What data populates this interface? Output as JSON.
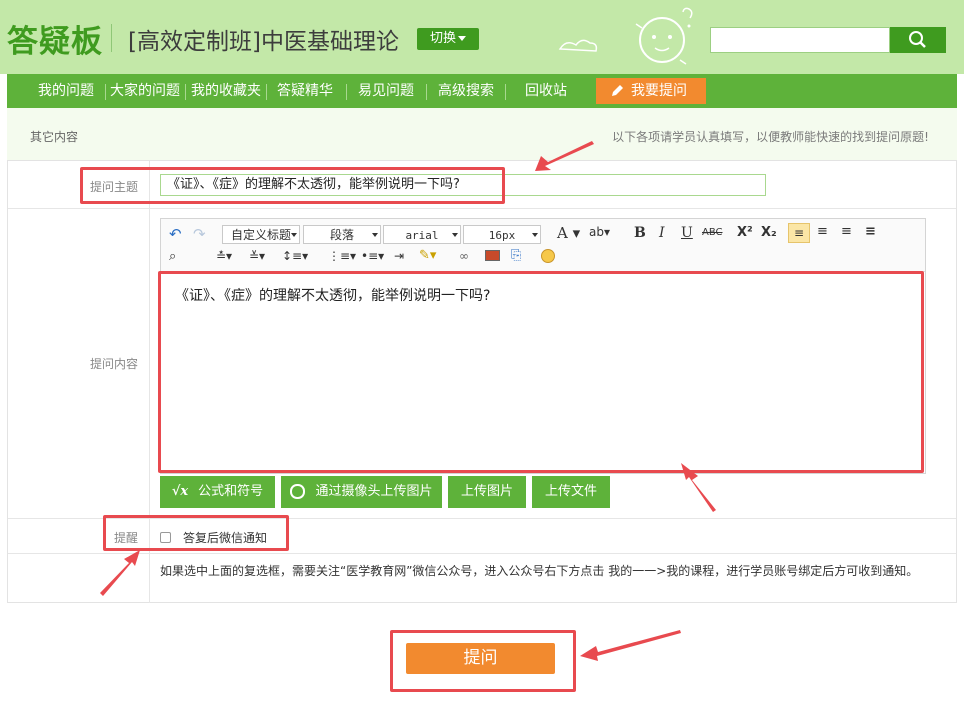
{
  "header": {
    "logo": "答疑板",
    "course_title": "[高效定制班]中医基础理论",
    "switch_label": "切换",
    "search": {
      "value": "",
      "placeholder": ""
    }
  },
  "nav": {
    "items": [
      "我的问题",
      "大家的问题",
      "我的收藏夹",
      "答疑精华",
      "易见问题",
      "高级搜索",
      "回收站"
    ],
    "ask_label": "我要提问"
  },
  "subbar": {
    "left": "其它内容",
    "right": "以下各项请学员认真填写，以便教师能快速的找到提问原题!"
  },
  "form": {
    "subject_label": "提问主题",
    "subject_value": "《证》、《症》的理解不太透彻，能举例说明一下吗?",
    "content_label": "提问内容",
    "toolbar": {
      "heading_select": "自定义标题",
      "paragraph_select": "段落",
      "font_select": "arial",
      "size_select": "16px"
    },
    "content_value": "《证》、《症》的理解不太透彻，能举例说明一下吗?",
    "buttons": {
      "formula": "公式和符号",
      "camera_upload": "通过摄像头上传图片",
      "upload_image": "上传图片",
      "upload_file": "上传文件"
    },
    "remind_label": "提醒",
    "wechat_label": "答复后微信通知",
    "notice": "如果选中上面的复选框，需要关注“医学教育网”微信公众号，进入公众号右下方点击 我的一一>我的课程，进行学员账号绑定后方可收到通知。"
  },
  "submit_label": "提问",
  "colors": {
    "green": "#5eb23a",
    "dark_green": "#3f9b1f",
    "orange": "#f28a2f",
    "annotation_red": "#e84a4f"
  }
}
